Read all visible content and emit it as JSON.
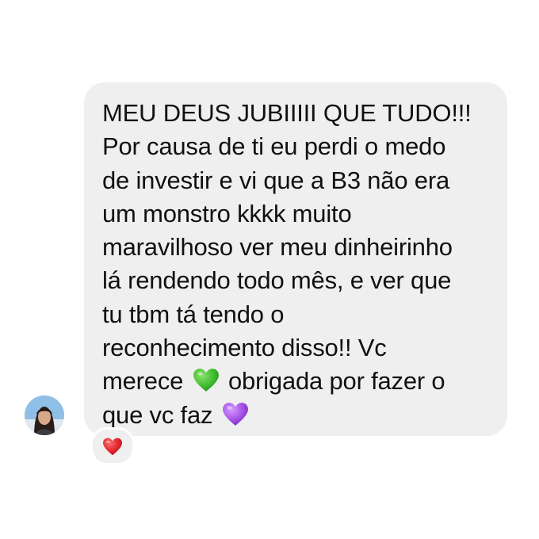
{
  "message": {
    "lines": [
      "MEU DEUS JUBIIIII QUE TUDO!!!",
      "Por causa de ti eu perdi o medo",
      "de investir e vi que a B3 não era",
      "um monstro kkkk muito",
      "maravilhoso ver meu dinheirinho",
      "lá rendendo todo mês, e ver que",
      "tu tbm tá tendo o",
      "reconhecimento disso!! Vc",
      "merece",
      "obrigada por fazer o",
      "que vc faz"
    ],
    "emojis": {
      "green": "green-heart-icon",
      "purple": "purple-heart-icon"
    },
    "colors": {
      "bubble": "#efefef",
      "text": "#111111",
      "green_heart": "#3dbb2f",
      "purple_heart": "#a34de6",
      "red_heart": "#e0242b"
    }
  },
  "reaction": {
    "icon": "red-heart-icon"
  },
  "sender": {
    "avatar": "avatar"
  }
}
